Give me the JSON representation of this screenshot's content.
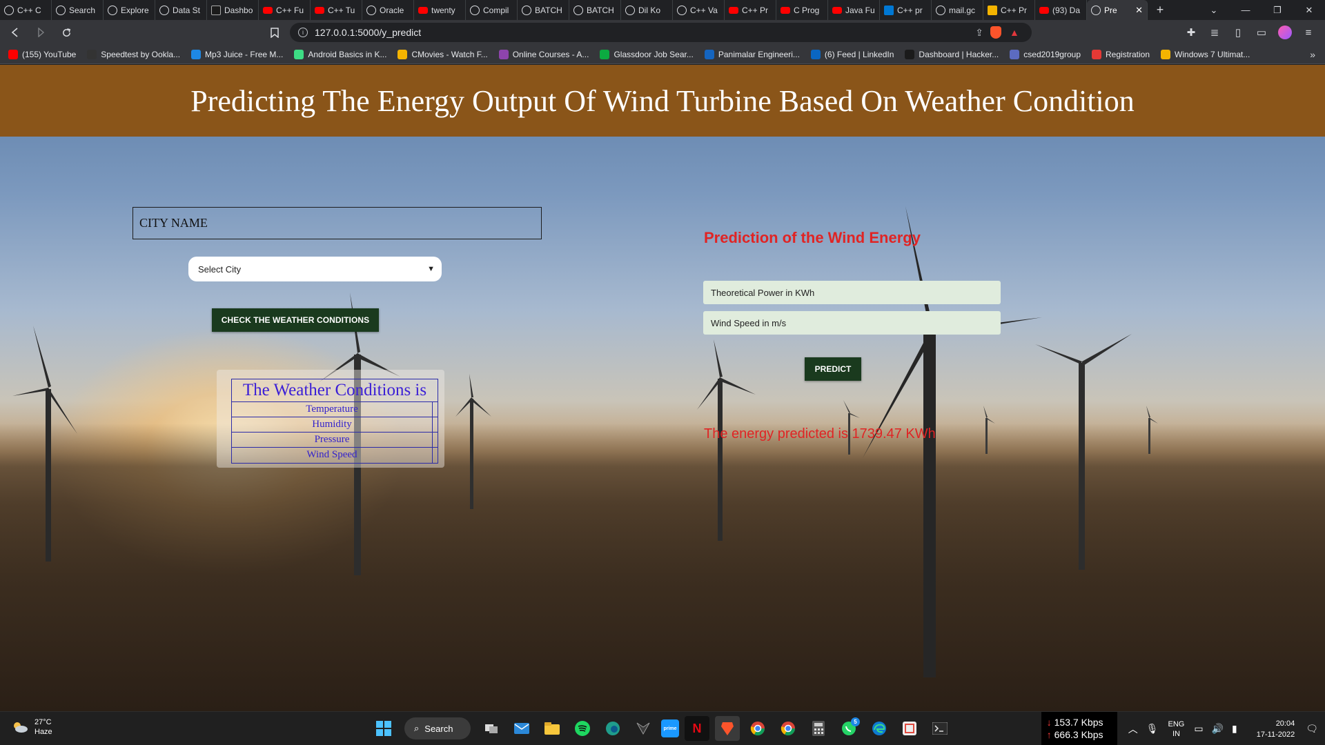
{
  "browser": {
    "tabs": [
      {
        "label": "C++ C",
        "icon": "globe"
      },
      {
        "label": "Search",
        "icon": "globe"
      },
      {
        "label": "Explore",
        "icon": "globe"
      },
      {
        "label": "Data St",
        "icon": "globe"
      },
      {
        "label": "Dashbo",
        "icon": "dark"
      },
      {
        "label": "C++ Fu",
        "icon": "yt"
      },
      {
        "label": "C++ Tu",
        "icon": "yt"
      },
      {
        "label": "Oracle",
        "icon": "globe"
      },
      {
        "label": "twenty",
        "icon": "yt"
      },
      {
        "label": "Compil",
        "icon": "globe"
      },
      {
        "label": "BATCH",
        "icon": "globe"
      },
      {
        "label": "BATCH",
        "icon": "globe"
      },
      {
        "label": "Dil Ko",
        "icon": "globe"
      },
      {
        "label": "C++ Va",
        "icon": "globe"
      },
      {
        "label": "C++ Pr",
        "icon": "yt"
      },
      {
        "label": "C Prog",
        "icon": "yt"
      },
      {
        "label": "Java Fu",
        "icon": "yt"
      },
      {
        "label": "C++ pr",
        "icon": "blue"
      },
      {
        "label": "mail.gc",
        "icon": "globe"
      },
      {
        "label": "C++ Pr",
        "icon": "gold"
      },
      {
        "label": "(93) Da",
        "icon": "yt"
      },
      {
        "label": "Pre",
        "icon": "globe",
        "active": true
      }
    ],
    "new_tab": "+",
    "url": "127.0.0.1:5000/y_predict",
    "bookmarks": [
      {
        "label": "(155) YouTube",
        "color": "#ff0000"
      },
      {
        "label": "Speedtest by Ookla...",
        "color": "#333333"
      },
      {
        "label": "Mp3 Juice - Free M...",
        "color": "#1e88e5"
      },
      {
        "label": "Android Basics in K...",
        "color": "#3ddc84"
      },
      {
        "label": "CMovies - Watch F...",
        "color": "#f4b400"
      },
      {
        "label": "Online Courses - A...",
        "color": "#8e44ad"
      },
      {
        "label": "Glassdoor Job Sear...",
        "color": "#0caa41"
      },
      {
        "label": "Panimalar Engineeri...",
        "color": "#1565c0"
      },
      {
        "label": "(6) Feed | LinkedIn",
        "color": "#0a66c2"
      },
      {
        "label": "Dashboard | Hacker...",
        "color": "#1b1b1b"
      },
      {
        "label": "csed2019group",
        "color": "#5c6bc0"
      },
      {
        "label": "Registration",
        "color": "#e53935"
      },
      {
        "label": "Windows 7 Ultimat...",
        "color": "#f4b400"
      }
    ],
    "bookmarks_more": "»"
  },
  "page": {
    "title": "Predicting The Energy Output Of Wind Turbine Based On Weather Condition",
    "city_input_placeholder": "CITY NAME",
    "city_select_value": "Select City",
    "check_weather_button": "CHECK THE WEATHER CONDITIONS",
    "weather_table": {
      "title": "The Weather Conditions is",
      "rows": [
        "Temperature",
        "Humidity",
        "Pressure",
        "Wind Speed"
      ]
    },
    "prediction_title": "Prediction of the Wind Energy",
    "theoretical_power_placeholder": "Theoretical Power in KWh",
    "wind_speed_placeholder": "Wind Speed in m/s",
    "predict_button": "PREDICT",
    "result_text": "The energy predicted is 1739.47 KWh",
    "header_color": "#8a5519",
    "accent_red": "#e02424"
  },
  "taskbar": {
    "weather_temp": "27°C",
    "weather_desc": "Haze",
    "search_label": "Search",
    "net_down": "153.7 Kbps",
    "net_up": "666.3 Kbps",
    "lang_top": "ENG",
    "lang_bottom": "IN",
    "time": "20:04",
    "date": "17-11-2022",
    "whatsapp_badge": "5"
  }
}
